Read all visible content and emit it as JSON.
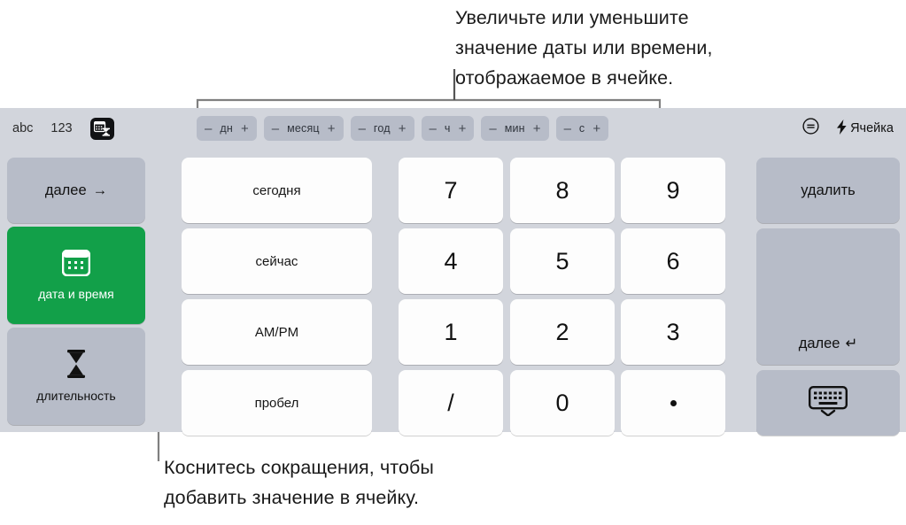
{
  "annotations": {
    "top": "Увеличьте или уменьшите\nзначение даты или времени,\nотображаемое в ячейке.",
    "bottom": "Коснитесь сокращения, чтобы\nдобавить значение в ячейку."
  },
  "toolbar": {
    "abc_label": "abc",
    "num_label": "123",
    "keyboard_mode_icon": "datetime-keypad-icon",
    "steppers": [
      {
        "minus": "–",
        "label": "дн",
        "plus": "+"
      },
      {
        "minus": "–",
        "label": "месяц",
        "plus": "+"
      },
      {
        "minus": "–",
        "label": "год",
        "plus": "+"
      },
      {
        "minus": "–",
        "label": "ч",
        "plus": "+"
      },
      {
        "minus": "–",
        "label": "мин",
        "plus": "+"
      },
      {
        "minus": "–",
        "label": "с",
        "plus": "+"
      }
    ],
    "format_icon": "circled-equals-icon",
    "cell_icon": "lightning-bolt-icon",
    "cell_label": "Ячейка"
  },
  "left_keys": [
    {
      "label": "далее",
      "glyph": "→",
      "icon": "",
      "style": "grey",
      "selected": false
    },
    {
      "label": "дата и время",
      "glyph": "",
      "icon": "calendar-icon",
      "style": "green",
      "selected": true
    },
    {
      "label": "длительность",
      "glyph": "",
      "icon": "hourglass-icon",
      "style": "grey",
      "selected": false
    }
  ],
  "shortcut_keys": [
    {
      "label": "сегодня"
    },
    {
      "label": "сейчас"
    },
    {
      "label": "AM/PM"
    },
    {
      "label": "пробел"
    }
  ],
  "numpad": [
    [
      "7",
      "8",
      "9"
    ],
    [
      "4",
      "5",
      "6"
    ],
    [
      "1",
      "2",
      "3"
    ],
    [
      "/",
      "0",
      "•"
    ]
  ],
  "right_keys": {
    "delete_label": "удалить",
    "next_label": "далее",
    "next_glyph": "↵",
    "hide_keyboard_icon": "hide-keyboard-icon"
  },
  "colors": {
    "keyboard_bg": "#d2d5dc",
    "key_white": "#fdfdfd",
    "key_grey": "#b7bcc8",
    "accent_green": "#12a049",
    "leader_line": "#808080",
    "text": "#111111"
  }
}
